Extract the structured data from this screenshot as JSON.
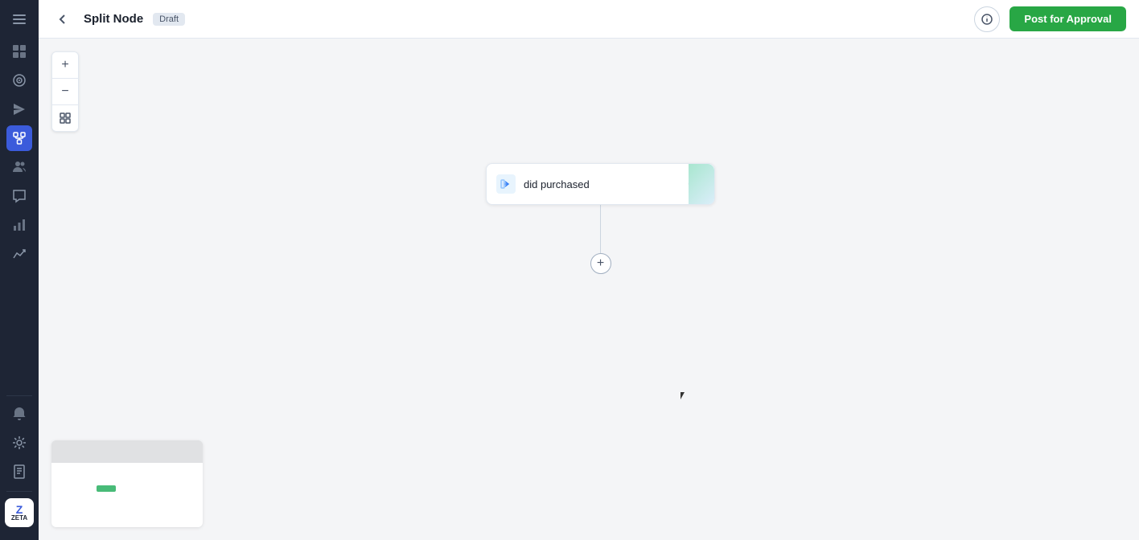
{
  "sidebar": {
    "items": [
      {
        "name": "menu-toggle",
        "icon": "☰",
        "active": false
      },
      {
        "name": "overview",
        "icon": "⊞",
        "active": false
      },
      {
        "name": "target",
        "icon": "◎",
        "active": false
      },
      {
        "name": "send",
        "icon": "➤",
        "active": false
      },
      {
        "name": "flow",
        "icon": "⬡",
        "active": true
      },
      {
        "name": "people",
        "icon": "⁂",
        "active": false
      },
      {
        "name": "chat",
        "icon": "✦",
        "active": false
      },
      {
        "name": "analytics",
        "icon": "↗",
        "active": false
      },
      {
        "name": "trends",
        "icon": "~",
        "active": false
      },
      {
        "name": "notifications",
        "icon": "🔔",
        "active": false
      },
      {
        "name": "integrations",
        "icon": "⊕",
        "active": false
      },
      {
        "name": "docs",
        "icon": "📖",
        "active": false
      }
    ]
  },
  "header": {
    "back_label": "‹",
    "title": "Split Node",
    "badge": "Draft",
    "info_title": "Info",
    "post_approval_label": "Post for Approval"
  },
  "zoom_controls": {
    "zoom_in": "+",
    "zoom_out": "−",
    "fit": "⊡"
  },
  "canvas": {
    "node": {
      "label": "did purchased",
      "menu": "···"
    },
    "add_button": "+"
  },
  "minimap": {}
}
